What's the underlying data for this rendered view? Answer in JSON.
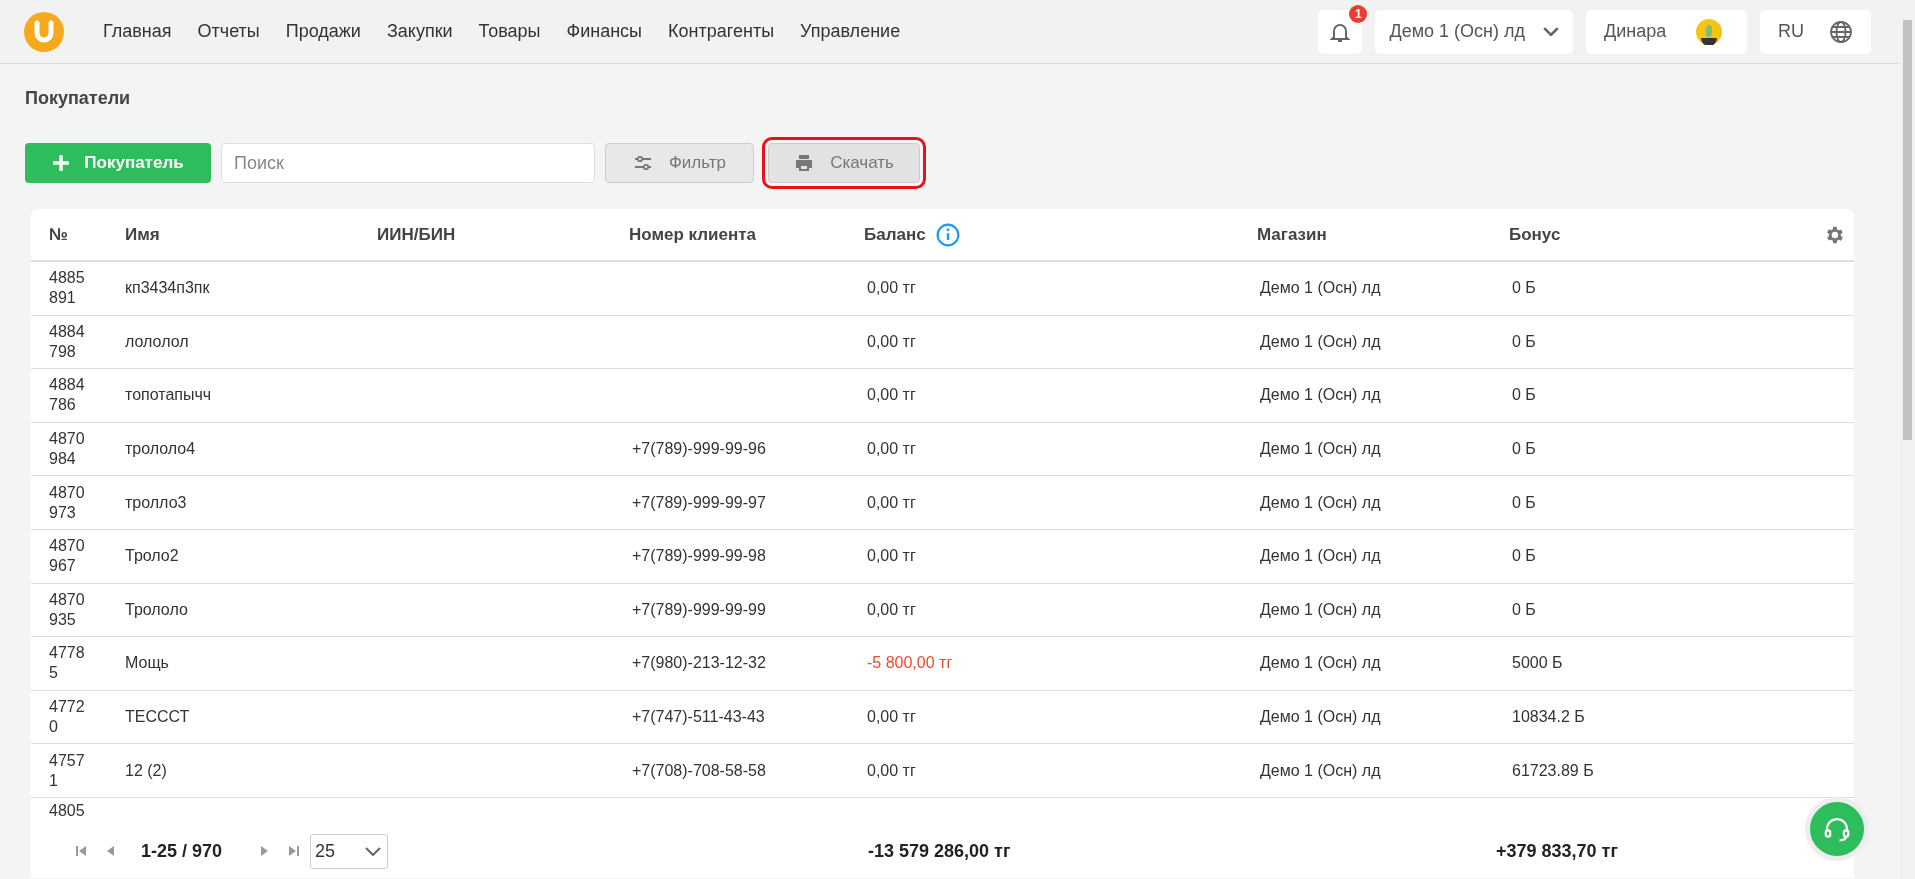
{
  "nav": {
    "items": [
      "Главная",
      "Отчеты",
      "Продажи",
      "Закупки",
      "Товары",
      "Финансы",
      "Контрагенты",
      "Управление"
    ],
    "notifications": "1",
    "store": "Демо 1 (Осн) лд",
    "user": "Динара",
    "language": "RU"
  },
  "page_title": "Покупатели",
  "toolbar": {
    "add_button": "Покупатель",
    "search": {
      "placeholder": "Поиск"
    },
    "buttons": [
      {
        "label": "Фильтр",
        "kind": "filter",
        "highlighted": false
      },
      {
        "label": "Скачать",
        "kind": "download",
        "highlighted": true
      }
    ]
  },
  "table": {
    "columns": [
      "№",
      "Имя",
      "ИИН/БИН",
      "Номер клиента",
      "Баланс",
      "Магазин",
      "Бонус"
    ],
    "rows": [
      {
        "no": "4885891",
        "name": "кп3434п3пк",
        "iin": "",
        "phone": "",
        "balance": "0,00 тг",
        "negative": false,
        "store": "Демо 1 (Осн) лд",
        "bonus": "0 Б"
      },
      {
        "no": "4884798",
        "name": "лололол",
        "iin": "",
        "phone": "",
        "balance": "0,00 тг",
        "negative": false,
        "store": "Демо 1 (Осн) лд",
        "bonus": "0 Б"
      },
      {
        "no": "4884786",
        "name": "топотапычч",
        "iin": "",
        "phone": "",
        "balance": "0,00 тг",
        "negative": false,
        "store": "Демо 1 (Осн) лд",
        "bonus": "0 Б"
      },
      {
        "no": "4870984",
        "name": "трололо4",
        "iin": "",
        "phone": "+7(789)-999-99-96",
        "balance": "0,00 тг",
        "negative": false,
        "store": "Демо 1 (Осн) лд",
        "bonus": "0 Б"
      },
      {
        "no": "4870973",
        "name": "тролло3",
        "iin": "",
        "phone": "+7(789)-999-99-97",
        "balance": "0,00 тг",
        "negative": false,
        "store": "Демо 1 (Осн) лд",
        "bonus": "0 Б"
      },
      {
        "no": "4870967",
        "name": "Троло2",
        "iin": "",
        "phone": "+7(789)-999-99-98",
        "balance": "0,00 тг",
        "negative": false,
        "store": "Демо 1 (Осн) лд",
        "bonus": "0 Б"
      },
      {
        "no": "4870935",
        "name": "Трололо",
        "iin": "",
        "phone": "+7(789)-999-99-99",
        "balance": "0,00 тг",
        "negative": false,
        "store": "Демо 1 (Осн) лд",
        "bonus": "0 Б"
      },
      {
        "no": "47785",
        "name": "Мощь",
        "iin": "",
        "phone": "+7(980)-213-12-32",
        "balance": "-5 800,00 тг",
        "negative": true,
        "store": "Демо 1 (Осн) лд",
        "bonus": "5000 Б"
      },
      {
        "no": "47720",
        "name": "ТЕСССТ",
        "iin": "",
        "phone": "+7(747)-511-43-43",
        "balance": "0,00 тг",
        "negative": false,
        "store": "Демо 1 (Осн) лд",
        "bonus": "10834.2 Б"
      },
      {
        "no": "47571",
        "name": "12 (2)",
        "iin": "",
        "phone": "+7(708)-708-58-58",
        "balance": "0,00 тг",
        "negative": false,
        "store": "Демо 1 (Осн) лд",
        "bonus": "61723.89 Б"
      }
    ],
    "cut_row_no": "4805"
  },
  "footer": {
    "range": "1-25 / 970",
    "page_size": "25",
    "total_balance": "-13 579 286,00 тг",
    "total_bonus": "+379 833,70 тг"
  }
}
